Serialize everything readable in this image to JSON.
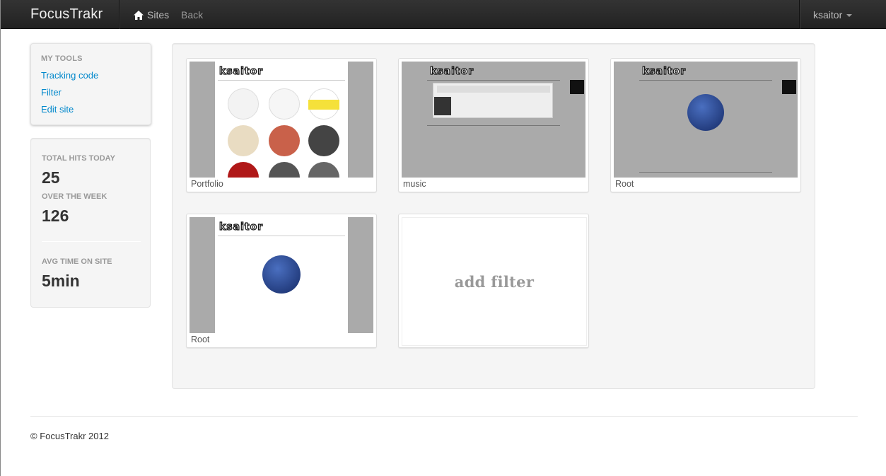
{
  "navbar": {
    "brand": "FocusTrakr",
    "sites_label": "Sites",
    "back_label": "Back",
    "user_label": "ksaitor"
  },
  "sidebar": {
    "header": "MY TOOLS",
    "items": [
      {
        "label": "Tracking code"
      },
      {
        "label": "Filter"
      },
      {
        "label": "Edit site"
      }
    ]
  },
  "stats": {
    "hits_today_label": "TOTAL HITS TODAY",
    "hits_today_value": "25",
    "week_label": "OVER THE WEEK",
    "week_value": "126",
    "avg_time_label": "AVG TIME ON SITE",
    "avg_time_value": "5min"
  },
  "thumbnails": [
    {
      "caption": "Portfolio",
      "logo": "ksaitor"
    },
    {
      "caption": "music",
      "logo": "ksaitor"
    },
    {
      "caption": "Root",
      "logo": "ksaitor"
    },
    {
      "caption": "Root",
      "logo": "ksaitor"
    }
  ],
  "add_filter_label": "add filter",
  "footer": {
    "text": "© FocusTrakr 2012"
  },
  "colors": {
    "navbar": "#222222",
    "link": "#0088cc",
    "well": "#f5f5f5"
  }
}
